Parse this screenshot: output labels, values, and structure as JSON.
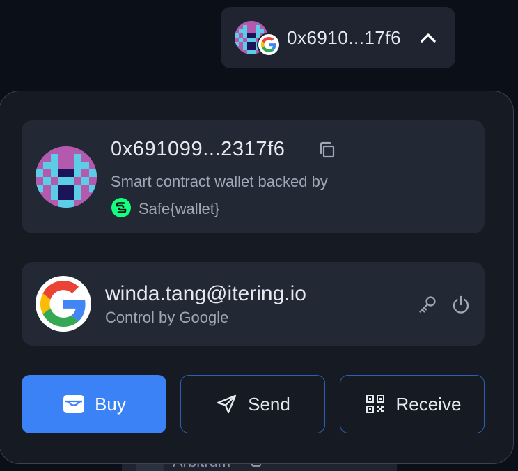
{
  "header": {
    "short_address": "0x6910...17f6",
    "avatar_icon": "pixel-identicon-icon",
    "badge_icon": "google-g-icon",
    "chevron_icon": "chevron-up-icon"
  },
  "wallet": {
    "address": "0x691099...2317f6",
    "copy_icon": "copy-icon",
    "description": "Smart contract wallet backed by",
    "provider_label": "Safe{wallet}",
    "provider_icon": "safe-logo-icon"
  },
  "account": {
    "email": "winda.tang@itering.io",
    "control_text": "Control by Google",
    "avatar_icon": "google-logo-icon",
    "key_icon": "key-icon",
    "power_icon": "power-icon"
  },
  "actions": {
    "buy_label": "Buy",
    "send_label": "Send",
    "receive_label": "Receive"
  },
  "background_item": {
    "label": "Arbitrum"
  },
  "colors": {
    "page_bg": "#0b0f17",
    "panel_bg": "#151a23",
    "card_bg": "#232835",
    "accent": "#3b82f6",
    "outline": "#2f5fb3",
    "identicon_pink": "#b45aae",
    "identicon_cyan": "#5ccde6",
    "identicon_dark": "#1c1458",
    "safe_green": "#12ff80"
  }
}
